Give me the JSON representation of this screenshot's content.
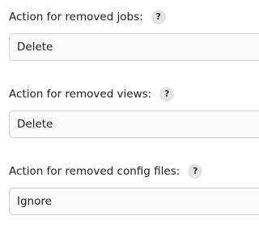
{
  "settings": [
    {
      "label": "Action for removed jobs:",
      "help": "?",
      "value": "Delete"
    },
    {
      "label": "Action for removed views:",
      "help": "?",
      "value": "Delete"
    },
    {
      "label": "Action for removed config files:",
      "help": "?",
      "value": "Ignore"
    }
  ]
}
